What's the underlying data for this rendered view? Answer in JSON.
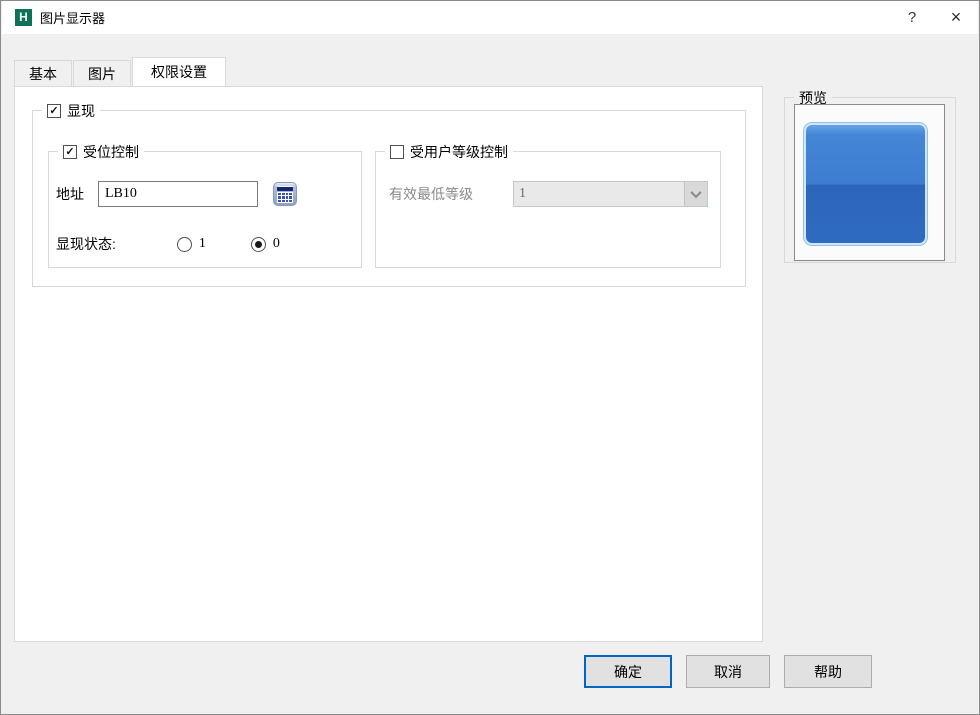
{
  "window": {
    "title": "图片显示器",
    "app_logo_letter": "H"
  },
  "icons": {
    "help": "?",
    "close": "×",
    "check": "✓"
  },
  "tabs": [
    {
      "label": "基本",
      "active": false
    },
    {
      "label": "图片",
      "active": false
    },
    {
      "label": "权限设置",
      "active": true
    }
  ],
  "panel": {
    "display_group": {
      "label": "显现",
      "checked": true
    },
    "bit_control_group": {
      "label": "受位控制",
      "checked": true,
      "address_label": "地址",
      "address_value": "LB10",
      "state_label": "显现状态:",
      "radios": [
        {
          "label": "1",
          "selected": false
        },
        {
          "label": "0",
          "selected": true
        }
      ]
    },
    "user_level_group": {
      "label": "受用户等级控制",
      "checked": false,
      "enabled": false,
      "level_label": "有效最低等级",
      "level_value": "1"
    }
  },
  "preview": {
    "label": "预览"
  },
  "footer": {
    "ok_label": "确定",
    "cancel_label": "取消",
    "help_label": "帮助"
  },
  "colors": {
    "default_button_border": "#0067c0",
    "preview_fill_top": "#4486d6",
    "preview_fill_bottom": "#2c66bb",
    "app_icon_green": "#0e7258"
  }
}
